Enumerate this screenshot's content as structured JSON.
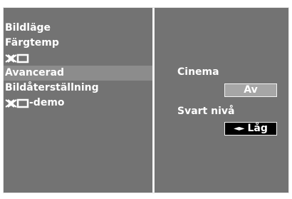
{
  "menu": {
    "items": [
      {
        "label": "Bildläge",
        "selected": false
      },
      {
        "label": "Färgtemp",
        "selected": false
      },
      {
        "label": "",
        "logo": "xd-logo",
        "selected": false
      },
      {
        "label": "Avancerad",
        "selected": true
      },
      {
        "label": "Bildåterställning",
        "selected": false
      },
      {
        "label": "-demo",
        "logo": "xd-logo",
        "selected": false
      }
    ]
  },
  "settings": {
    "cinema_label": "Cinema",
    "cinema_value": "Av",
    "black_level_label": "Svart nivå",
    "black_level_value": "Låg",
    "black_level_arrows": "◄►"
  },
  "colors": {
    "panel_bg": "#737373",
    "selected_row": "#8c8c8c",
    "value_box": "#a6a6a6",
    "selector_box": "#000000",
    "text": "#ffffff"
  }
}
